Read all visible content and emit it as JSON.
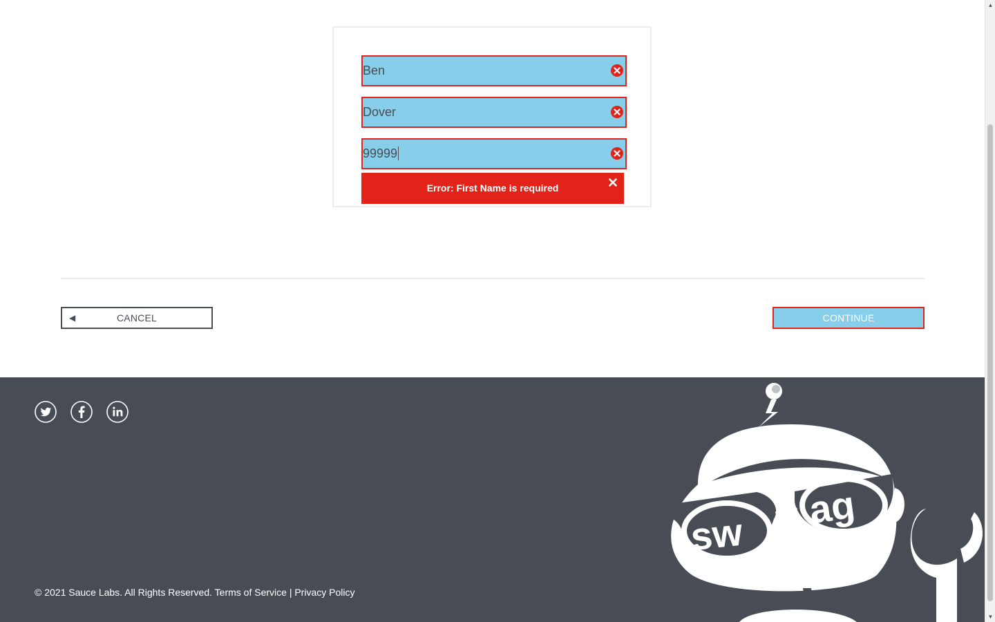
{
  "form": {
    "first_name": "Ben",
    "last_name": "Dover",
    "postal_code": "99999",
    "error_message": "Error: First Name is required"
  },
  "actions": {
    "cancel_label": "CANCEL",
    "cancel_arrow": "◀",
    "continue_label": "CONTINUE"
  },
  "footer": {
    "social": [
      "twitter-icon",
      "facebook-icon",
      "linkedin-icon"
    ],
    "copyright": "© 2021 Sauce Labs. All Rights Reserved.",
    "terms_label": "Terms of Service",
    "separator": "|",
    "privacy_label": "Privacy Policy"
  },
  "colors": {
    "input_bg": "#87ceeb",
    "error_red": "#e2231a",
    "footer_bg": "#474c55",
    "text_dark": "#484c55"
  }
}
